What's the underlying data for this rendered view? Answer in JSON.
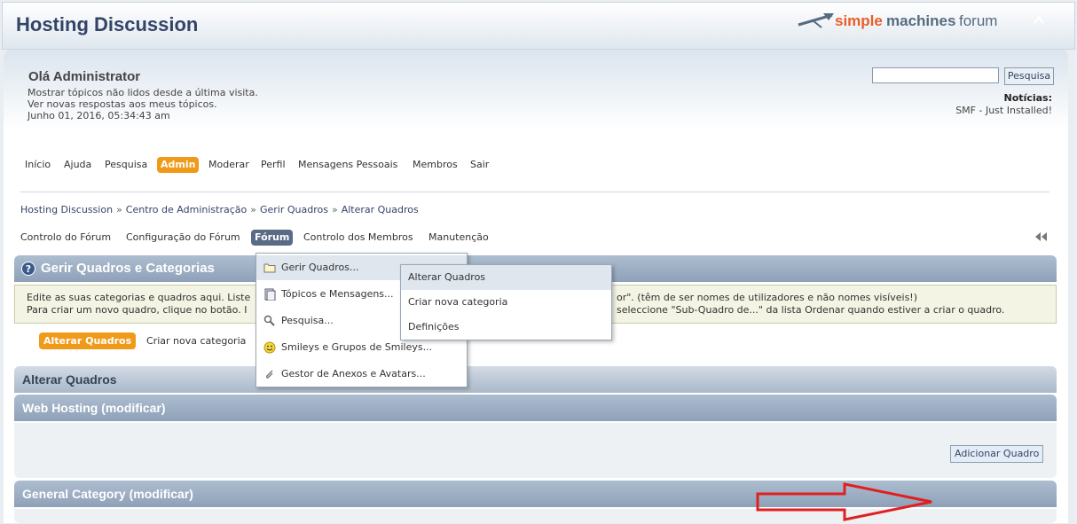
{
  "forum_title": "Hosting Discussion",
  "logo": {
    "word1": "simple",
    "word2": "machines",
    "word3": "forum",
    "collapse_icon": "chevron-up-icon"
  },
  "user": {
    "greeting": "Olá Administrator",
    "line1": "Mostrar tópicos não lidos desde a última visita.",
    "line2": "Ver novas respostas aos meus tópicos.",
    "line3": "Junho 01, 2016, 05:34:43 am"
  },
  "search": {
    "value": "",
    "button": "Pesquisa"
  },
  "news": {
    "title": "Notícias:",
    "text": "SMF - Just Installed!"
  },
  "main_menu": [
    "Início",
    "Ajuda",
    "Pesquisa",
    "Admin",
    "Moderar",
    "Perfil",
    "Mensagens Pessoais",
    "Membros",
    "Sair"
  ],
  "main_menu_active": "Admin",
  "breadcrumb": [
    "Hosting Discussion",
    "Centro de Administração",
    "Gerir Quadros",
    "Alterar Quadros"
  ],
  "admin_tabs": [
    "Controlo do Fórum",
    "Configuração do Fórum",
    "Fórum",
    "Controlo dos Membros",
    "Manutenção"
  ],
  "admin_tab_active": "Fórum",
  "section": {
    "title": "Gerir Quadros e Categorias"
  },
  "info": {
    "line1_left": "Edite as suas categorias e quadros aqui. Liste",
    "line1_right": "or\". (têm de ser nomes de utilizadores e não nomes visíveis!)",
    "line2_left": "Para criar um novo quadro, clique no botão. I",
    "line2_right": "seleccione \"Sub-Quadro de...\" da lista Ordenar quando estiver a criar o quadro."
  },
  "sub_buttons": {
    "alterar": "Alterar Quadros",
    "criar": "Criar nova categoria"
  },
  "categories": [
    {
      "title": "Alterar Quadros"
    },
    {
      "title": "Web Hosting (modificar)"
    },
    {
      "title": "General Category (modificar)"
    }
  ],
  "add_board_button": "Adicionar Quadro",
  "forum_dropdown": [
    {
      "label": "Gerir Quadros...",
      "icon": "folder-icon"
    },
    {
      "label": "Tópicos e Mensagens...",
      "icon": "document-icon"
    },
    {
      "label": "Pesquisa...",
      "icon": "magnifier-icon"
    },
    {
      "label": "Smileys e Grupos de Smileys...",
      "icon": "smiley-icon"
    },
    {
      "label": "Gestor de Anexos e Avatars...",
      "icon": "paperclip-icon"
    }
  ],
  "board_submenu": [
    "Alterar Quadros",
    "Criar nova categoria",
    "Definições"
  ],
  "colors": {
    "accent": "#f09a1a",
    "header_blue": "#334466",
    "arrow_red": "#e02020"
  }
}
